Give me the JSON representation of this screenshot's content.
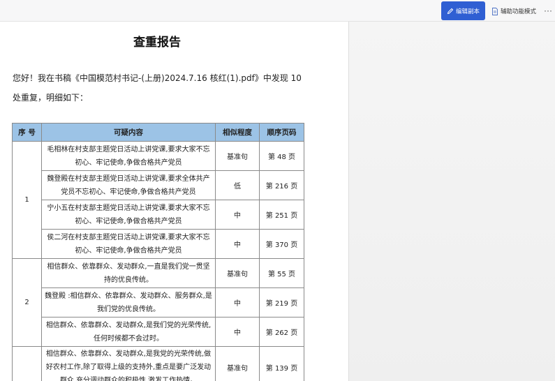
{
  "toolbar": {
    "edit_copy_label": "编辑副本",
    "accessibility_label": "辅助功能模式",
    "more_label": "···",
    "accent_color": "#2f5fd3"
  },
  "document": {
    "title": "查重报告",
    "intro": "您好！我在书稿《中国模范村书记-(上册)2024.7.16 核红(1).pdf》中发现 10 处重复，明细如下：",
    "table": {
      "headers": [
        "序 号",
        "可疑内容",
        "相似程度",
        "顺序页码"
      ],
      "header_color": "#9cc3e6",
      "groups": [
        {
          "index": "1",
          "rows": [
            {
              "content": "毛相林在村支部主题党日活动上讲党课,要求大家不忘 初心、牢记使命,争做合格共产党员",
              "similarity": "基准句",
              "page": "第 48 页"
            },
            {
              "content": "魏登殿在村支部主题党日活动上讲党课,要求全体共产 党员不忘初心、牢记使命,争做合格共产党员",
              "similarity": "低",
              "page": "第 216 页"
            },
            {
              "content": "宁小五在村支部主题党日活动上讲党课,要求大家不忘 初心、牢记使命,争做合格共产党员",
              "similarity": "中",
              "page": "第 251 页"
            },
            {
              "content": "侯二河在村支部主题党日活动上讲党课,要求大家不忘 初心、牢记使命,争做合格共产党员",
              "similarity": "中",
              "page": "第 370 页"
            }
          ]
        },
        {
          "index": "2",
          "rows": [
            {
              "content": "相信群众、依靠群众、发动群众,一直是我们党一贯坚 持的优良传统。",
              "similarity": "基准句",
              "page": "第 55 页"
            },
            {
              "content": "魏登殿 :相信群众、依靠群众、发动群众、服务群众,是我们党的优良传统。",
              "similarity": "中",
              "page": "第 219 页"
            },
            {
              "content": "相信群众、依靠群众、发动群众,是我们党的光荣传统,任何时候都不会过时。",
              "similarity": "中",
              "page": "第 262 页"
            }
          ]
        },
        {
          "index": "",
          "rows": [
            {
              "content": "相信群众、依靠群众、发动群众,是我党的光荣传统,做好农村工作,除了取得上级的支持外,重点是要广泛发动群众,充分调动群众的积极性,激发工作热情。",
              "similarity": "基准句",
              "page": "第 139 页"
            }
          ]
        }
      ]
    }
  }
}
